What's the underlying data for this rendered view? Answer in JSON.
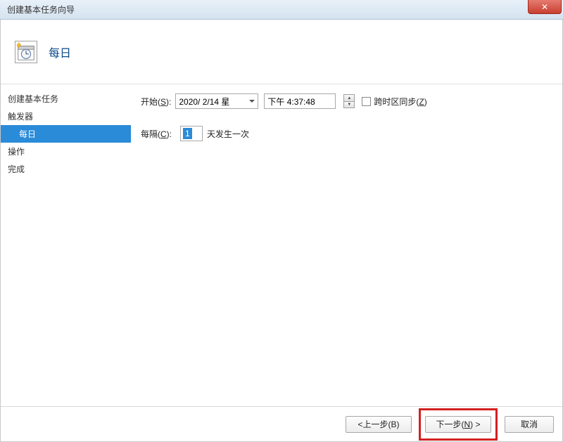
{
  "titlebar": {
    "title": "创建基本任务向导"
  },
  "header": {
    "title": "每日"
  },
  "sidebar": {
    "items": [
      {
        "label": "创建基本任务",
        "selected": false,
        "indent": false
      },
      {
        "label": "触发器",
        "selected": false,
        "indent": false
      },
      {
        "label": "每日",
        "selected": true,
        "indent": true
      },
      {
        "label": "操作",
        "selected": false,
        "indent": false
      },
      {
        "label": "完成",
        "selected": false,
        "indent": false
      }
    ]
  },
  "form": {
    "start_label_prefix": "开始(",
    "start_label_key": "S",
    "start_label_suffix": "):",
    "date_value": "2020/ 2/14 星",
    "time_value": "下午   4:37:48",
    "tz_label_prefix": "跨时区同步(",
    "tz_label_key": "Z",
    "tz_label_suffix": ")",
    "recur_label_prefix": "每隔(",
    "recur_label_key": "C",
    "recur_label_suffix": "):",
    "recur_value": "1",
    "recur_unit": "天发生一次"
  },
  "footer": {
    "back_label": "<上一步(B)",
    "next_label": "下一步(N) >",
    "cancel_label": "取消"
  }
}
